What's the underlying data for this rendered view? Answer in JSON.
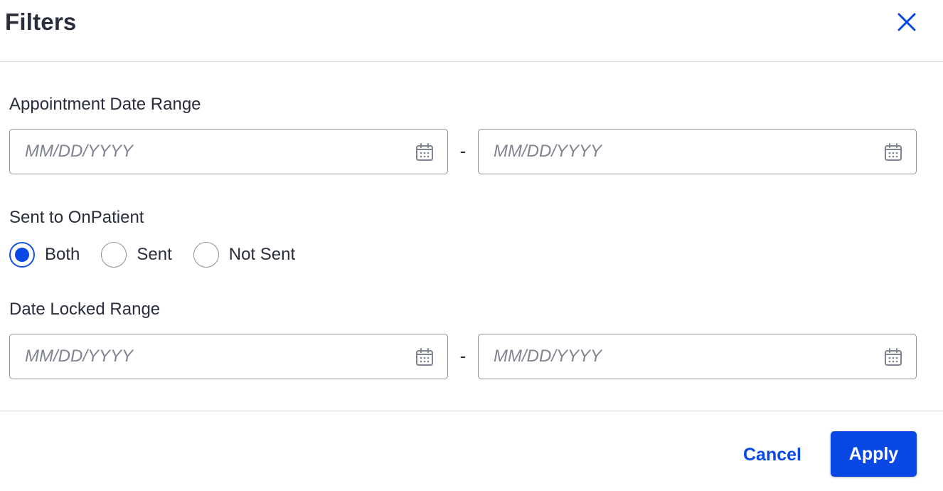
{
  "dialog": {
    "title": "Filters",
    "close_icon": "close-icon"
  },
  "appointment_date_range": {
    "label": "Appointment Date Range",
    "start": {
      "value": "",
      "placeholder": "MM/DD/YYYY",
      "icon": "calendar-icon"
    },
    "separator": "-",
    "end": {
      "value": "",
      "placeholder": "MM/DD/YYYY",
      "icon": "calendar-icon"
    }
  },
  "sent_to_onpatient": {
    "label": "Sent to OnPatient",
    "options": [
      {
        "label": "Both",
        "checked": true
      },
      {
        "label": "Sent",
        "checked": false
      },
      {
        "label": "Not Sent",
        "checked": false
      }
    ]
  },
  "date_locked_range": {
    "label": "Date Locked Range",
    "start": {
      "value": "",
      "placeholder": "MM/DD/YYYY",
      "icon": "calendar-icon"
    },
    "separator": "-",
    "end": {
      "value": "",
      "placeholder": "MM/DD/YYYY",
      "icon": "calendar-icon"
    }
  },
  "footer": {
    "cancel_label": "Cancel",
    "apply_label": "Apply"
  },
  "colors": {
    "accent": "#0a48e6",
    "text": "#2a2d3b",
    "placeholder": "#808390",
    "border": "#8e9099",
    "divider": "#d4d6db"
  }
}
